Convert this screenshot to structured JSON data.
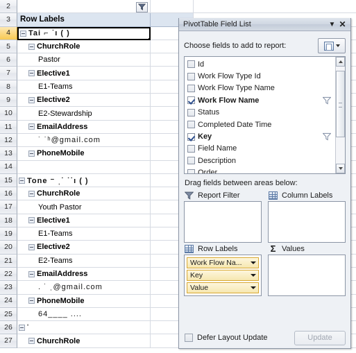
{
  "sheet": {
    "column_header_filter_icon": "filter-icon",
    "rows": [
      {
        "num": "2",
        "label": "",
        "indent": 0,
        "bold": false,
        "toggle": false,
        "type": "blank"
      },
      {
        "num": "3",
        "label": "Row Labels",
        "indent": 0,
        "bold": true,
        "toggle": false,
        "type": "header"
      },
      {
        "num": "4",
        "label": "Tai ⌐  ˙ı ( )",
        "indent": 0,
        "bold": true,
        "toggle": true,
        "type": "item",
        "selected": true,
        "redacted": true
      },
      {
        "num": "5",
        "label": "ChurchRole",
        "indent": 1,
        "bold": true,
        "toggle": true,
        "type": "item"
      },
      {
        "num": "6",
        "label": "Pastor",
        "indent": 2,
        "bold": false,
        "toggle": false,
        "type": "item"
      },
      {
        "num": "7",
        "label": "Elective1",
        "indent": 1,
        "bold": true,
        "toggle": true,
        "type": "item"
      },
      {
        "num": "8",
        "label": "E1-Teams",
        "indent": 2,
        "bold": false,
        "toggle": false,
        "type": "item"
      },
      {
        "num": "9",
        "label": "Elective2",
        "indent": 1,
        "bold": true,
        "toggle": true,
        "type": "item"
      },
      {
        "num": "10",
        "label": "E2-Stewardship",
        "indent": 2,
        "bold": false,
        "toggle": false,
        "type": "item"
      },
      {
        "num": "11",
        "label": "EmailAddress",
        "indent": 1,
        "bold": true,
        "toggle": true,
        "type": "item"
      },
      {
        "num": "12",
        "label": "˙     ˙ʰ@gmail.com",
        "indent": 2,
        "bold": false,
        "toggle": false,
        "type": "item",
        "redacted": true
      },
      {
        "num": "13",
        "label": "PhoneMobile",
        "indent": 1,
        "bold": true,
        "toggle": true,
        "type": "item"
      },
      {
        "num": "14",
        "label": "",
        "indent": 0,
        "bold": false,
        "toggle": false,
        "type": "blank"
      },
      {
        "num": "15",
        "label": "Tone ⁻ ˌ˙ ˙˙ı ( )",
        "indent": 0,
        "bold": true,
        "toggle": true,
        "type": "item",
        "redacted": true
      },
      {
        "num": "16",
        "label": "ChurchRole",
        "indent": 1,
        "bold": true,
        "toggle": true,
        "type": "item"
      },
      {
        "num": "17",
        "label": "Youth Pastor",
        "indent": 2,
        "bold": false,
        "toggle": false,
        "type": "item"
      },
      {
        "num": "18",
        "label": "Elective1",
        "indent": 1,
        "bold": true,
        "toggle": true,
        "type": "item"
      },
      {
        "num": "19",
        "label": "E1-Teams",
        "indent": 2,
        "bold": false,
        "toggle": false,
        "type": "item"
      },
      {
        "num": "20",
        "label": "Elective2",
        "indent": 1,
        "bold": true,
        "toggle": true,
        "type": "item"
      },
      {
        "num": "21",
        "label": "E2-Teams",
        "indent": 2,
        "bold": false,
        "toggle": false,
        "type": "item"
      },
      {
        "num": "22",
        "label": "EmailAddress",
        "indent": 1,
        "bold": true,
        "toggle": true,
        "type": "item"
      },
      {
        "num": "23",
        "label": ".    ˙ ˌ@gmail.com",
        "indent": 2,
        "bold": false,
        "toggle": false,
        "type": "item",
        "redacted": true
      },
      {
        "num": "24",
        "label": "PhoneMobile",
        "indent": 1,
        "bold": true,
        "toggle": true,
        "type": "item"
      },
      {
        "num": "25",
        "label": "64____ ....",
        "indent": 2,
        "bold": false,
        "toggle": false,
        "type": "item",
        "redacted": true
      },
      {
        "num": "26",
        "label": "'",
        "indent": 0,
        "bold": false,
        "toggle": true,
        "type": "item",
        "redacted": true
      },
      {
        "num": "27",
        "label": "ChurchRole",
        "indent": 1,
        "bold": true,
        "toggle": true,
        "type": "item"
      }
    ]
  },
  "pane": {
    "title": "PivotTable Field List",
    "minimize_icon": "chevron-down-icon",
    "close_icon": "close-icon",
    "choose_label": "Choose fields to add to report:",
    "field_list_button_icon": "field-list-layout-icon",
    "fields": [
      {
        "label": "Id",
        "checked": false,
        "filtered": false
      },
      {
        "label": "Work Flow Type Id",
        "checked": false,
        "filtered": false
      },
      {
        "label": "Work Flow Type Name",
        "checked": false,
        "filtered": false
      },
      {
        "label": "Work Flow Name",
        "checked": true,
        "filtered": true
      },
      {
        "label": "Status",
        "checked": false,
        "filtered": false
      },
      {
        "label": "Completed Date Time",
        "checked": false,
        "filtered": false
      },
      {
        "label": "Key",
        "checked": true,
        "filtered": true
      },
      {
        "label": "Field Name",
        "checked": false,
        "filtered": false
      },
      {
        "label": "Description",
        "checked": false,
        "filtered": false
      },
      {
        "label": "Order",
        "checked": false,
        "filtered": false
      }
    ],
    "drag_label": "Drag fields between areas below:",
    "areas": [
      {
        "name": "report-filter",
        "label": "Report Filter",
        "icon": "filter-icon",
        "fields": []
      },
      {
        "name": "column-labels",
        "label": "Column Labels",
        "icon": "grid-icon",
        "fields": []
      },
      {
        "name": "row-labels",
        "label": "Row Labels",
        "icon": "grid-icon",
        "fields": [
          {
            "label": "Work Flow Na..."
          },
          {
            "label": "Key"
          },
          {
            "label": "Value"
          }
        ]
      },
      {
        "name": "values",
        "label": "Values",
        "icon": "sigma-icon",
        "fields": []
      }
    ],
    "defer_label": "Defer Layout Update",
    "update_label": "Update",
    "update_enabled": false
  },
  "colors": {
    "header_fill": "#dce5f0",
    "active_row_header": "#f8ca54",
    "pivot_field_button": "#f6e7b0",
    "pivot_field_border": "#d8a832",
    "pane_background": "#eef1f5"
  }
}
